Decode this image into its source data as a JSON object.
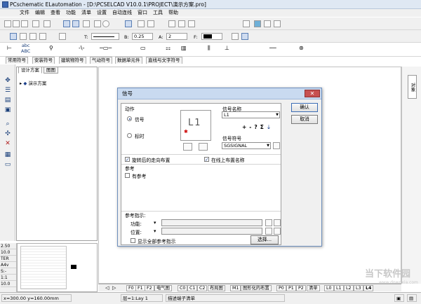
{
  "window": {
    "title": "PCschematic ELautomation - [D:\\PCSELCAD V10.0.1\\PROJECT\\演示方案.pro]"
  },
  "menu": [
    "文件",
    "编辑",
    "查看",
    "功能",
    "清单",
    "设置",
    "自动连线",
    "窗口",
    "工具",
    "帮助"
  ],
  "format_toolbar": {
    "text_label": "T:",
    "line_label": "B:",
    "line_value": "0.25",
    "angle_label": "A:",
    "angle_value": "2",
    "color_label": "F:"
  },
  "symbol_tabs": [
    "常用符号",
    "安装符号",
    "建筑物符号",
    "气动符号",
    "数据单元件",
    "直线与文字符号"
  ],
  "symbol_texts": {
    "abc1": "abc",
    "abc2": "ABC"
  },
  "left_panel": {
    "tabs": [
      "设计方案",
      "图图"
    ],
    "tree_root": "演示方案"
  },
  "status_values": [
    "2.50",
    "10.0",
    "TER",
    "A4v",
    "S:-",
    "1:1",
    "10.0"
  ],
  "page_tabs": [
    "F0",
    "F1",
    "F2",
    "电气图",
    "C0",
    "C1",
    "C2",
    "布局图",
    "M1",
    "图形化的布置",
    "P0",
    "P1",
    "P2",
    "清单",
    "L0",
    "L1",
    "L2",
    "L3",
    "L4"
  ],
  "right_panel": {
    "vertical_tab": "对象"
  },
  "statusbar": {
    "coords": "x=300.00 y=160.00mm",
    "layer": "层=1:Lay 1",
    "hint": "描述端子清单"
  },
  "watermark": {
    "main": "当下软件园",
    "sub": "www.downxia.com"
  },
  "dialog": {
    "title": "信号",
    "action_label": "动作",
    "radio_signal": "信号",
    "radio_source": "标时",
    "preview_text": "L1",
    "signal_name_label": "信号名称",
    "signal_name_value": "L1",
    "tool_plus": "+",
    "tool_minus": "-",
    "tool_q": "?",
    "tool_sigma": "Σ",
    "signal_symbol_label": "信号符号",
    "signal_symbol_value": "SGSIGNAL",
    "checkbox_reverse": "旋转后的走向布置",
    "checkbox_online": "在线上布置名称",
    "reference_label": "参考",
    "checkbox_has_ref": "有参考",
    "ref_indicator_label": "参考指示:",
    "func_label": "功能:",
    "pos_label": "位置:",
    "checkbox_show_all": "显示全部参考指示",
    "select_button": "选择...",
    "ok_button": "确认",
    "cancel_button": "取消"
  }
}
